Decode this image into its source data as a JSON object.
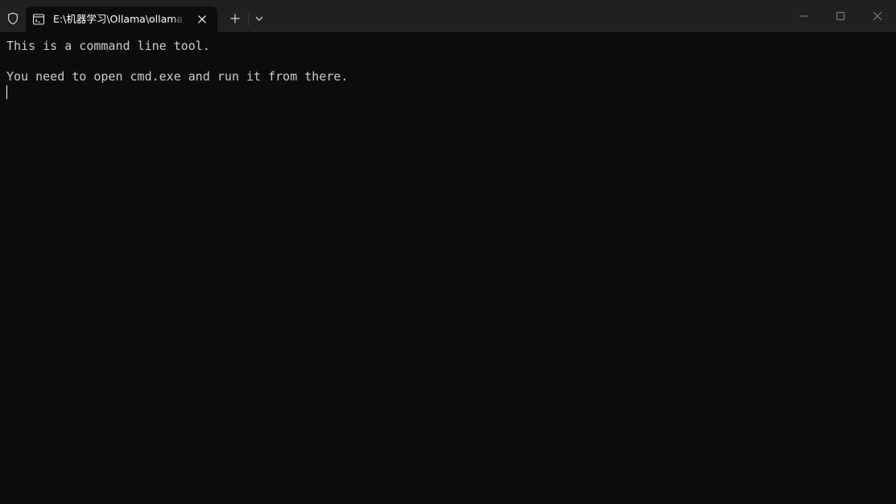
{
  "window": {
    "tab_title": "E:\\机器学习\\Ollama\\ollama.exe"
  },
  "icons": {
    "shield": "shield-icon",
    "tab": "console-icon",
    "tab_close": "close-icon",
    "new_tab": "plus-icon",
    "dropdown": "chevron-down-icon",
    "minimize": "minimize-icon",
    "maximize": "maximize-icon",
    "close": "close-icon"
  },
  "terminal": {
    "lines": [
      "This is a command line tool.",
      "You need to open cmd.exe and run it from there."
    ]
  },
  "colors": {
    "titlebar": "#202020",
    "background": "#0c0c0c",
    "text": "#cccccc"
  }
}
